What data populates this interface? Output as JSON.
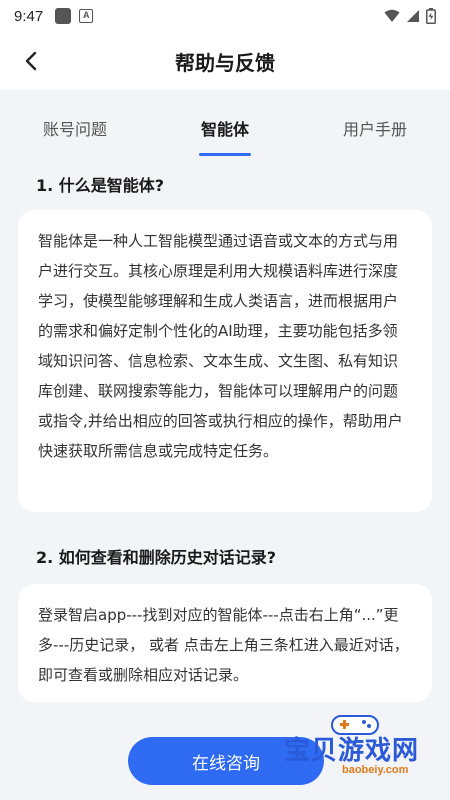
{
  "status": {
    "time": "9:47"
  },
  "header": {
    "title": "帮助与反馈"
  },
  "tabs": [
    {
      "label": "账号问题"
    },
    {
      "label": "智能体"
    },
    {
      "label": "用户手册"
    }
  ],
  "faq": [
    {
      "question": "1. 什么是智能体?",
      "answer": "智能体是一种人工智能模型通过语音或文本的方式与用户进行交互。其核心原理是利用大规模语料库进行深度学习，使模型能够理解和生成人类语言，进而根据用户的需求和偏好定制个性化的AI助理，主要功能包括多领域知识问答、信息检索、文本生成、文生图、私有知识库创建、联网搜索等能力，智能体可以理解用户的问题或指令,并给出相应的回答或执行相应的操作，帮助用户快速获取所需信息或完成特定任务。"
    },
    {
      "question": "2. 如何查看和删除历史对话记录?",
      "answer": "登录智启app---找到对应的智能体---点击右上角“...”更多---历史记录， 或者 点击左上角三条杠进入最近对话，即可查看或删除相应对话记录。"
    }
  ],
  "consult_button": {
    "label": "在线咨询"
  },
  "watermark": {
    "text": "宝贝游戏网",
    "url": "baobeiy.com"
  },
  "colors": {
    "accent": "#2f6bf2",
    "background": "#f3f4f8"
  }
}
